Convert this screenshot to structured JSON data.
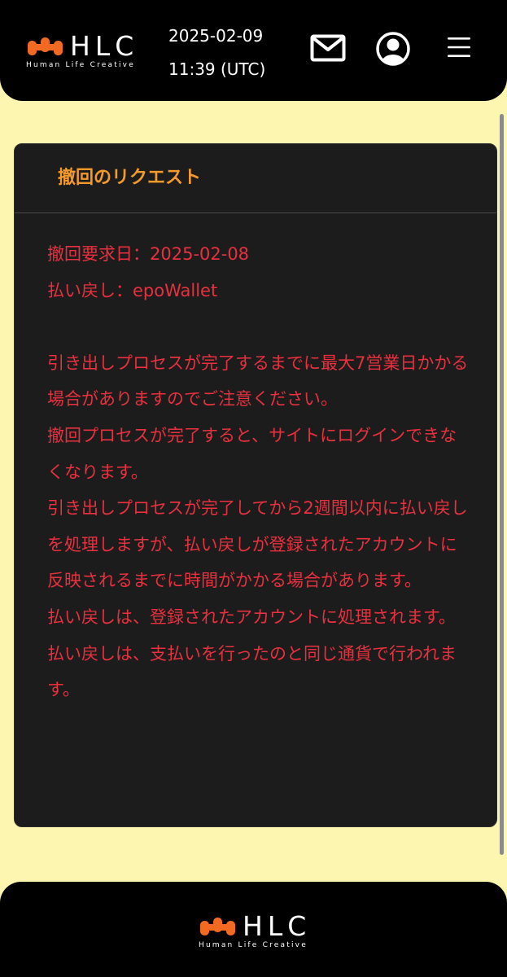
{
  "header": {
    "brand": "HLC",
    "tagline": "Human Life Creative",
    "date": "2025-02-09",
    "time": "11:39 (UTC)",
    "icons": [
      "mail-icon",
      "user-icon",
      "menu-icon"
    ]
  },
  "card": {
    "title": "撤回のリクエスト",
    "lines": [
      "撤回要求日：2025-02-08",
      "払い戻し：epoWallet"
    ],
    "notes": [
      "引き出しプロセスが完了するまでに最大7営業日かかる場合がありますのでご注意ください。",
      "撤回プロセスが完了すると、サイトにログインできなくなります。",
      "引き出しプロセスが完了してから2週間以内に払い戻しを処理しますが、払い戻しが登録されたアカウントに反映されるまでに時間がかかる場合があります。",
      "払い戻しは、登録されたアカウントに処理されます。",
      "払い戻しは、支払いを行ったのと同じ通貨で行われます。"
    ]
  },
  "footer": {
    "brand": "HLC",
    "tagline": "Human Life Creative"
  },
  "colors": {
    "accent": "#f39a2b",
    "alert_text": "#e8303f",
    "background": "#fdf6b0",
    "panel": "#1c1c1c"
  }
}
